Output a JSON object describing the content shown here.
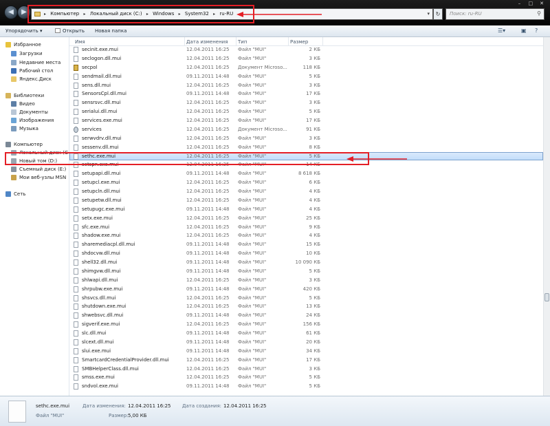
{
  "address_bar": {
    "crumbs": [
      "Компьютер",
      "Локальный диск (C:)",
      "Windows",
      "System32",
      "ru-RU"
    ],
    "search_placeholder": "Поиск: ru-RU"
  },
  "toolbar": {
    "organize": "Упорядочить",
    "open": "Открыть",
    "new_folder": "Новая папка"
  },
  "sidebar": {
    "favorites": "Избранное",
    "downloads": "Загрузки",
    "recent": "Недавние места",
    "desktop": "Рабочий стол",
    "yandex_disk": "Яндекс.Диск",
    "libraries": "Библиотеки",
    "video": "Видео",
    "documents": "Документы",
    "images": "Изображения",
    "music": "Музыка",
    "computer": "Компьютер",
    "local_disk": "Локальный диск (C",
    "new_volume": "Новый том (D:)",
    "removable": "Съемный диск (E:)",
    "msn": "Мои веб-узлы MSN",
    "network": "Сеть"
  },
  "columns": {
    "name": "Имя",
    "date": "Дата изменения",
    "type": "Тип",
    "size": "Размер"
  },
  "files": [
    {
      "name": "secinit.exe.mui",
      "date": "12.04.2011 16:25",
      "type": "Файл \"MUI\"",
      "size": "2 КБ"
    },
    {
      "name": "seclogon.dll.mui",
      "date": "12.04.2011 16:25",
      "type": "Файл \"MUI\"",
      "size": "3 КБ"
    },
    {
      "name": "secpol",
      "date": "12.04.2011 16:25",
      "type": "Документ Microso...",
      "size": "118 КБ"
    },
    {
      "name": "sendmail.dll.mui",
      "date": "09.11.2011 14:48",
      "type": "Файл \"MUI\"",
      "size": "5 КБ"
    },
    {
      "name": "sens.dll.mui",
      "date": "12.04.2011 16:25",
      "type": "Файл \"MUI\"",
      "size": "3 КБ"
    },
    {
      "name": "SensorsCpl.dll.mui",
      "date": "09.11.2011 14:48",
      "type": "Файл \"MUI\"",
      "size": "17 КБ"
    },
    {
      "name": "sensrsvc.dll.mui",
      "date": "12.04.2011 16:25",
      "type": "Файл \"MUI\"",
      "size": "3 КБ"
    },
    {
      "name": "serialui.dll.mui",
      "date": "12.04.2011 16:25",
      "type": "Файл \"MUI\"",
      "size": "5 КБ"
    },
    {
      "name": "services.exe.mui",
      "date": "12.04.2011 16:25",
      "type": "Файл \"MUI\"",
      "size": "17 КБ"
    },
    {
      "name": "services",
      "date": "12.04.2011 16:25",
      "type": "Документ Microso...",
      "size": "91 КБ"
    },
    {
      "name": "serwvdrv.dll.mui",
      "date": "12.04.2011 16:25",
      "type": "Файл \"MUI\"",
      "size": "3 КБ"
    },
    {
      "name": "sessenv.dll.mui",
      "date": "12.04.2011 16:25",
      "type": "Файл \"MUI\"",
      "size": "8 КБ"
    },
    {
      "name": "sethc.exe.mui",
      "date": "12.04.2011 16:25",
      "type": "Файл \"MUI\"",
      "size": "5 КБ"
    },
    {
      "name": "setspn.exe.mui",
      "date": "12.04.2011 16:25",
      "type": "Файл \"MUI\"",
      "size": "14 КБ"
    },
    {
      "name": "setupapi.dll.mui",
      "date": "09.11.2011 14:48",
      "type": "Файл \"MUI\"",
      "size": "8 618 КБ"
    },
    {
      "name": "setupcl.exe.mui",
      "date": "12.04.2011 16:25",
      "type": "Файл \"MUI\"",
      "size": "6 КБ"
    },
    {
      "name": "setupcln.dll.mui",
      "date": "12.04.2011 16:25",
      "type": "Файл \"MUI\"",
      "size": "4 КБ"
    },
    {
      "name": "setupetw.dll.mui",
      "date": "12.04.2011 16:25",
      "type": "Файл \"MUI\"",
      "size": "4 КБ"
    },
    {
      "name": "setupugc.exe.mui",
      "date": "09.11.2011 14:48",
      "type": "Файл \"MUI\"",
      "size": "4 КБ"
    },
    {
      "name": "setx.exe.mui",
      "date": "12.04.2011 16:25",
      "type": "Файл \"MUI\"",
      "size": "25 КБ"
    },
    {
      "name": "sfc.exe.mui",
      "date": "12.04.2011 16:25",
      "type": "Файл \"MUI\"",
      "size": "9 КБ"
    },
    {
      "name": "shadow.exe.mui",
      "date": "12.04.2011 16:25",
      "type": "Файл \"MUI\"",
      "size": "4 КБ"
    },
    {
      "name": "sharemediacpl.dll.mui",
      "date": "09.11.2011 14:48",
      "type": "Файл \"MUI\"",
      "size": "15 КБ"
    },
    {
      "name": "shdocvw.dll.mui",
      "date": "09.11.2011 14:48",
      "type": "Файл \"MUI\"",
      "size": "10 КБ"
    },
    {
      "name": "shell32.dll.mui",
      "date": "09.11.2011 14:48",
      "type": "Файл \"MUI\"",
      "size": "10 090 КБ"
    },
    {
      "name": "shimgvw.dll.mui",
      "date": "09.11.2011 14:48",
      "type": "Файл \"MUI\"",
      "size": "5 КБ"
    },
    {
      "name": "shlwapi.dll.mui",
      "date": "12.04.2011 16:25",
      "type": "Файл \"MUI\"",
      "size": "3 КБ"
    },
    {
      "name": "shrpubw.exe.mui",
      "date": "09.11.2011 14:48",
      "type": "Файл \"MUI\"",
      "size": "420 КБ"
    },
    {
      "name": "shsvcs.dll.mui",
      "date": "12.04.2011 16:25",
      "type": "Файл \"MUI\"",
      "size": "5 КБ"
    },
    {
      "name": "shutdown.exe.mui",
      "date": "12.04.2011 16:25",
      "type": "Файл \"MUI\"",
      "size": "13 КБ"
    },
    {
      "name": "shwebsvc.dll.mui",
      "date": "09.11.2011 14:48",
      "type": "Файл \"MUI\"",
      "size": "24 КБ"
    },
    {
      "name": "sigverif.exe.mui",
      "date": "12.04.2011 16:25",
      "type": "Файл \"MUI\"",
      "size": "156 КБ"
    },
    {
      "name": "slc.dll.mui",
      "date": "09.11.2011 14:48",
      "type": "Файл \"MUI\"",
      "size": "61 КБ"
    },
    {
      "name": "slcext.dll.mui",
      "date": "09.11.2011 14:48",
      "type": "Файл \"MUI\"",
      "size": "20 КБ"
    },
    {
      "name": "slui.exe.mui",
      "date": "09.11.2011 14:48",
      "type": "Файл \"MUI\"",
      "size": "34 КБ"
    },
    {
      "name": "SmartcardCredentialProvider.dll.mui",
      "date": "12.04.2011 16:25",
      "type": "Файл \"MUI\"",
      "size": "17 КБ"
    },
    {
      "name": "SMBHelperClass.dll.mui",
      "date": "12.04.2011 16:25",
      "type": "Файл \"MUI\"",
      "size": "3 КБ"
    },
    {
      "name": "smss.exe.mui",
      "date": "12.04.2011 16:25",
      "type": "Файл \"MUI\"",
      "size": "5 КБ"
    },
    {
      "name": "sndvol.exe.mui",
      "date": "09.11.2011 14:48",
      "type": "Файл \"MUI\"",
      "size": "5 КБ"
    }
  ],
  "selected_index": 12,
  "details": {
    "name": "sethc.exe.mui",
    "type": "Файл \"MUI\"",
    "modified_label": "Дата изменения:",
    "modified_value": "12.04.2011 16:25",
    "created_label": "Дата создания:",
    "created_value": "12.04.2011 16:25",
    "size_label": "Размер:",
    "size_value": "5,00 КБ"
  },
  "colors": {
    "annotation_red": "#e41f26",
    "selection": "#c1dcfa"
  }
}
